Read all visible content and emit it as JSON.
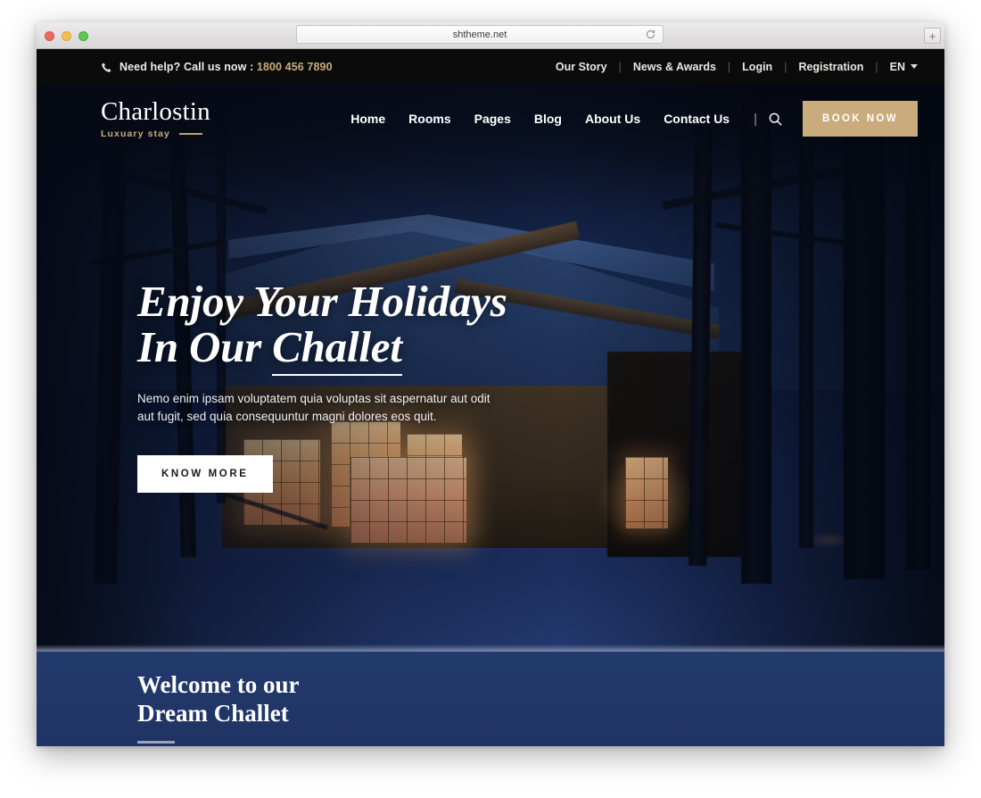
{
  "browser": {
    "url": "shtheme.net",
    "reload_icon": "reload-icon",
    "new_tab_icon": "plus-icon",
    "traffic_lights": [
      "close",
      "minimize",
      "maximize"
    ]
  },
  "topbar": {
    "phone_icon": "phone-icon",
    "help_text": "Need help? Call us now : ",
    "phone_number": "1800 456 7890",
    "links": [
      {
        "label": "Our Story"
      },
      {
        "label": "News & Awards"
      },
      {
        "label": "Login"
      },
      {
        "label": "Registration"
      }
    ],
    "separator": "|",
    "language": "EN",
    "language_caret": "chevron-down-icon"
  },
  "header": {
    "logo_name": "Charlostin",
    "logo_tagline": "Luxuary stay",
    "nav": [
      {
        "label": "Home"
      },
      {
        "label": "Rooms"
      },
      {
        "label": "Pages"
      },
      {
        "label": "Blog"
      },
      {
        "label": "About Us"
      },
      {
        "label": "Contact Us"
      }
    ],
    "nav_separator": "|",
    "search_icon": "search-icon",
    "book_label": "BOOK NOW"
  },
  "hero": {
    "title_line1": "Enjoy Your Holidays",
    "title_line2_pre": "In Our ",
    "title_line2_underlined": "Challet",
    "subtitle": "Nemo enim ipsam voluptatem quia voluptas sit aspernatur aut odit aut fugit, sed quia consequuntur magni dolores eos quit.",
    "cta_label": "KNOW MORE"
  },
  "welcome": {
    "line1": "Welcome to our",
    "line2": "Dream Challet"
  },
  "colors": {
    "accent_gold": "#c9ab7c",
    "topbar_bg": "#0b0b0b",
    "navy_section": "#23396b",
    "hero_text": "#ffffff"
  }
}
